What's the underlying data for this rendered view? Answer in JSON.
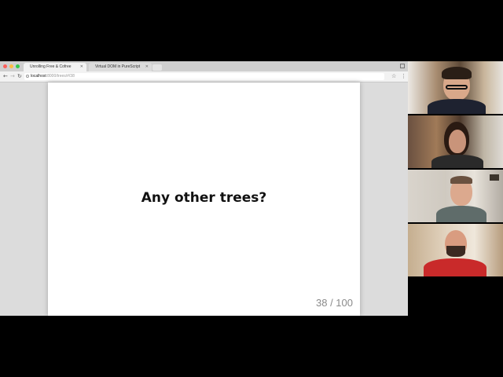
{
  "browser": {
    "tabs": [
      {
        "label": "Unrolling Free & Cofree",
        "active": true
      },
      {
        "label": "Virtual DOM in PureScript",
        "active": false
      }
    ],
    "url": {
      "host": "localhost",
      "path": ":8000/trees/#/38"
    },
    "traffic_colors": [
      "#fc605c",
      "#fdbc40",
      "#34c84a"
    ]
  },
  "slide": {
    "title": "Any other trees?",
    "number": "38 / 100"
  },
  "participants": [
    {
      "id": "participant-1",
      "shirt": "#1e2230",
      "skin": "#d9a88a",
      "hair": "#2a1e16"
    },
    {
      "id": "participant-2",
      "shirt": "#2a2a2a",
      "skin": "#c9947a",
      "hair": "#2a1a12"
    },
    {
      "id": "participant-3",
      "shirt": "#5f6c6a",
      "skin": "#dca98e",
      "hair": "#6a5140"
    },
    {
      "id": "participant-4",
      "shirt": "#c92a2a",
      "skin": "#d99c80",
      "hair": "#3b2a22"
    }
  ]
}
